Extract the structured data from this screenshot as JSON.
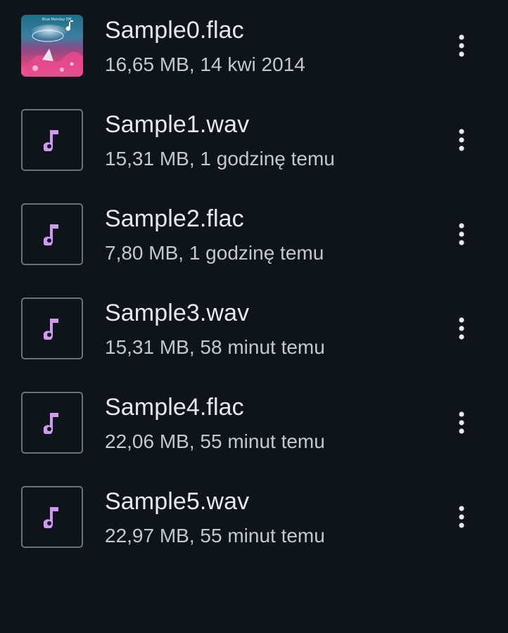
{
  "colors": {
    "background": "#0f141a",
    "title_text": "#e6e8ec",
    "meta_text": "#c3c8cf",
    "icon_accent": "#d19af2",
    "thumb_border": "#6d7278",
    "more_icon": "#e6e8ec"
  },
  "files": [
    {
      "name": "Sample0.flac",
      "details": "16,65 MB, 14 kwi 2014",
      "thumbnail": "album-art",
      "icon": "music-note-icon",
      "artwork_caption": "Blue Monday EM"
    },
    {
      "name": "Sample1.wav",
      "details": "15,31 MB, 1 godzinę temu",
      "thumbnail": "music-note-icon",
      "icon": "more-vert-icon"
    },
    {
      "name": "Sample2.flac",
      "details": "7,80 MB, 1 godzinę temu",
      "thumbnail": "music-note-icon",
      "icon": "more-vert-icon"
    },
    {
      "name": "Sample3.wav",
      "details": "15,31 MB, 58 minut temu",
      "thumbnail": "music-note-icon",
      "icon": "more-vert-icon"
    },
    {
      "name": "Sample4.flac",
      "details": "22,06 MB, 55 minut temu",
      "thumbnail": "music-note-icon",
      "icon": "more-vert-icon"
    },
    {
      "name": "Sample5.wav",
      "details": "22,97 MB, 55 minut temu",
      "thumbnail": "music-note-icon",
      "icon": "more-vert-icon"
    }
  ]
}
